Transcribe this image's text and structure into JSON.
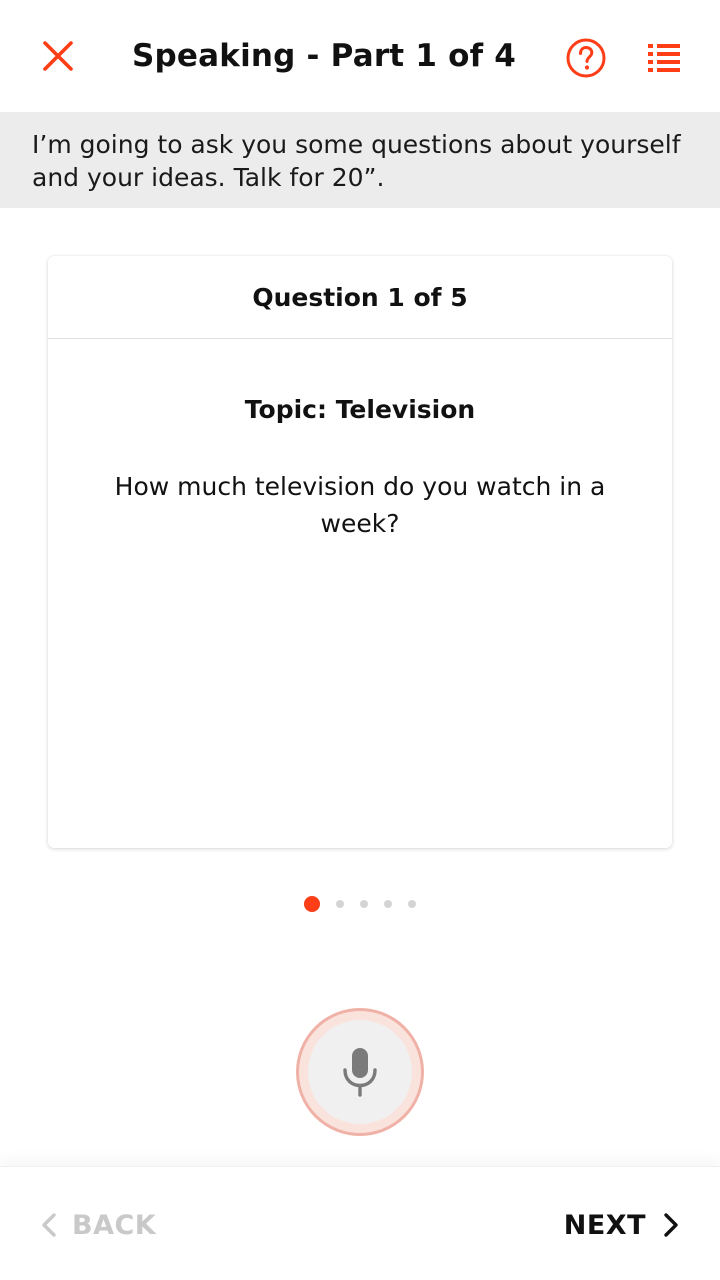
{
  "header": {
    "title": "Speaking - Part 1 of 4",
    "close_icon": "close-icon",
    "help_icon": "help-icon",
    "list_icon": "list-icon"
  },
  "instruction": {
    "text": "I’m going to ask you some questions about yourself and your ideas. Talk for 20”."
  },
  "card": {
    "question_counter": "Question 1 of 5",
    "topic": "Topic: Television",
    "question": "How much television do you watch in a week?"
  },
  "pagination": {
    "total": 5,
    "current": 1
  },
  "mic": {
    "icon": "microphone-icon"
  },
  "footer": {
    "back_label": "BACK",
    "next_label": "NEXT",
    "back_enabled": false
  },
  "colors": {
    "accent": "#ff3d17",
    "instruction_bg": "#ececec",
    "disabled": "#c9c9c9",
    "mic_ring": "#f0b2a6"
  }
}
